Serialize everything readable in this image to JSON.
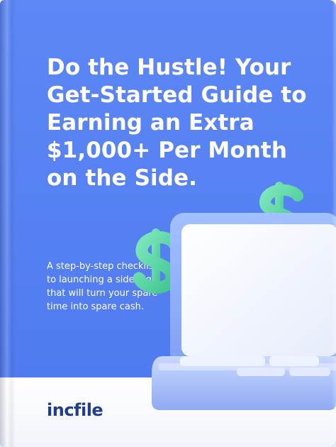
{
  "cover": {
    "title": "Do the Hustle! Your Get-Started Guide to Earning an Extra $1,000+ Per Month on the Side.",
    "subtitle": "A step-by-step checklist to launching a side gig that will turn your spare time into spare cash.",
    "brand": "incfile"
  },
  "colors": {
    "cover_blue": "#5580f2",
    "dollar_green": "#5fd6a4",
    "laptop_blue": "#8eb1ff",
    "logo_navy": "#1f3d8a"
  },
  "icons": {
    "dollar_sign": "dollar-icon",
    "device": "laptop-icon"
  }
}
